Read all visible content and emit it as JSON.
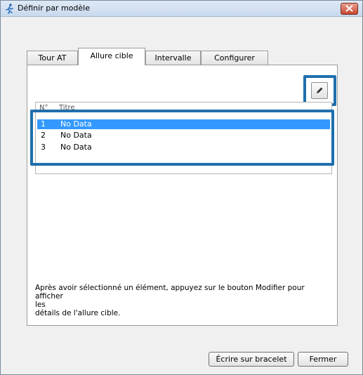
{
  "window": {
    "title": "Définir par modèle"
  },
  "tabs": [
    {
      "label": "Tour AT"
    },
    {
      "label": "Allure cible"
    },
    {
      "label": "Intervalle"
    },
    {
      "label": "Configurer"
    }
  ],
  "list": {
    "columns": [
      "N°",
      "Titre"
    ],
    "rows": [
      {
        "num": "1",
        "name": "No Data",
        "selected": true
      },
      {
        "num": "2",
        "name": "No Data",
        "selected": false
      },
      {
        "num": "3",
        "name": "No Data",
        "selected": false
      }
    ]
  },
  "hint": {
    "line1": "Après avoir sélectionné un élément, appuyez sur le bouton Modifier pour afficher",
    "line2": "les",
    "line3": "détails de l'allure cible."
  },
  "buttons": {
    "write": "Écrire sur bracelet",
    "close": "Fermer"
  },
  "colors": {
    "selection": "#3399ff",
    "highlight": "#1f6fad"
  },
  "icons": {
    "edit": "pencil-icon",
    "close": "close-icon",
    "app": "runner-icon"
  }
}
